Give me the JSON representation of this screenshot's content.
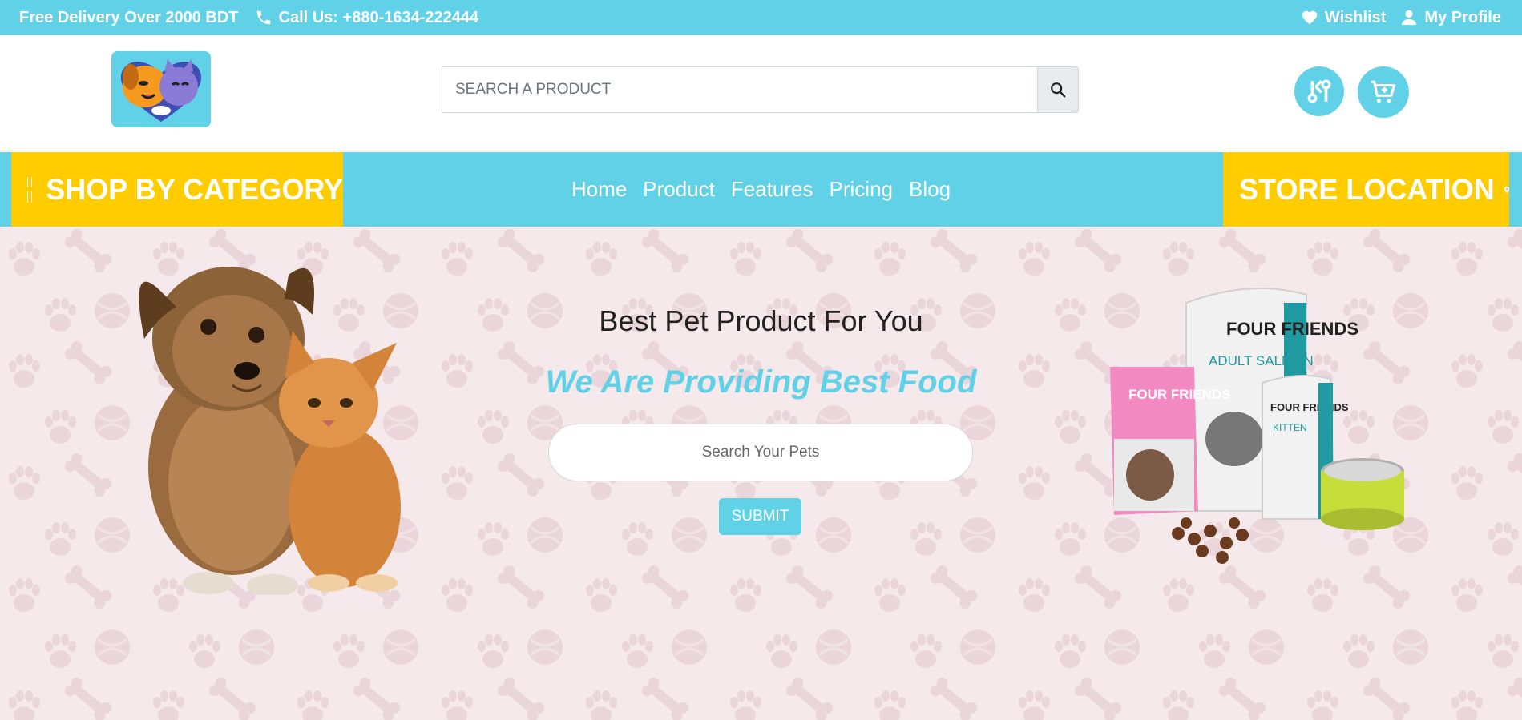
{
  "topbar": {
    "delivery": "Free Delivery Over 2000 BDT",
    "phone": "Call Us: +880-1634-222444",
    "wishlist": "Wishlist",
    "profile": "My Profile"
  },
  "header": {
    "search_placeholder": "SEARCH A PRODUCT"
  },
  "navbar": {
    "shop_category": "SHOP BY CATEGORY",
    "links": [
      "Home",
      "Product",
      "Features",
      "Pricing",
      "Blog"
    ],
    "store_location": "STORE LOCATION"
  },
  "hero": {
    "title": "Best Pet Product For You",
    "subtitle": "We Are Providing Best Food",
    "search_placeholder": "Search Your Pets",
    "submit_label": "SUBMIT"
  },
  "colors": {
    "primary": "#61d1e8",
    "accent": "#ffcc00",
    "hero_bg": "#f5e9ec"
  },
  "product_labels": {
    "brand": "FOUR FRIENDS",
    "variant_1": "ADULT SALMON",
    "variant_2": "KITTEN"
  }
}
